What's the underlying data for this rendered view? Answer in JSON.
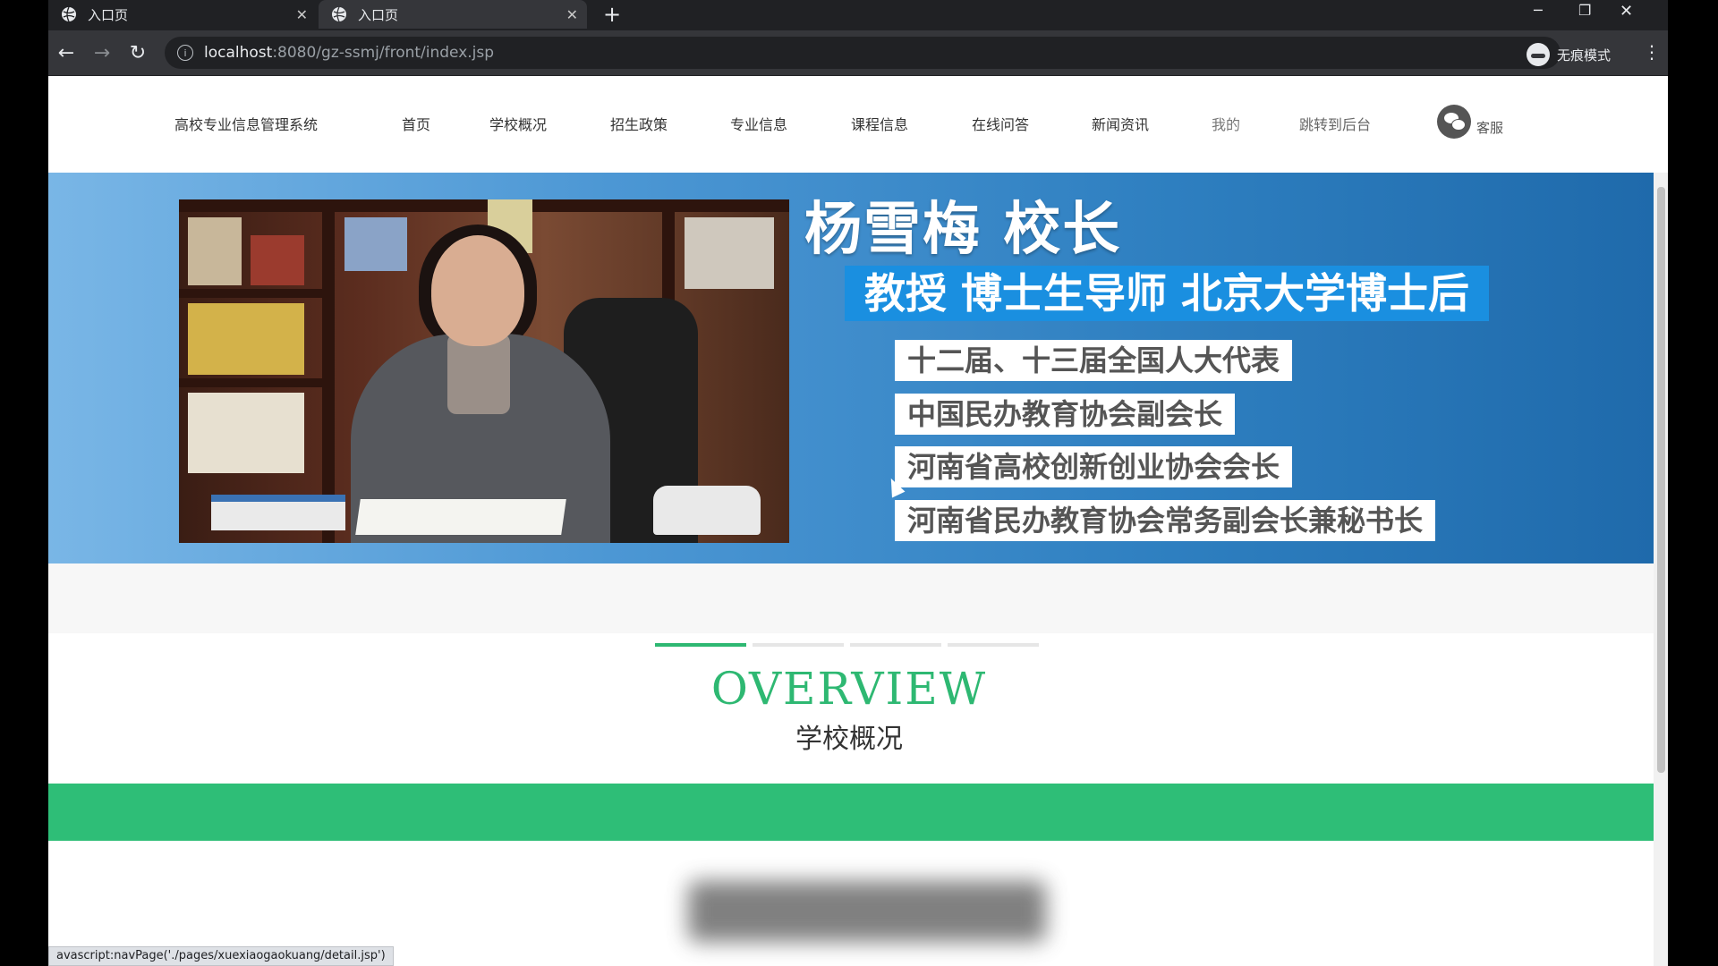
{
  "browser": {
    "tabs": [
      {
        "title": "入口页",
        "active": false
      },
      {
        "title": "入口页",
        "active": true
      }
    ],
    "new_tab": "+",
    "window_controls": {
      "minimize": "─",
      "restore": "❐",
      "close": "✕"
    },
    "url": {
      "host": "localhost",
      "rest": ":8080/gz-ssmj/front/index.jsp"
    },
    "incognito_label": "无痕模式",
    "status_text": "avascript:navPage('./pages/xuexiaogaokuang/detail.jsp')"
  },
  "nav": {
    "brand": "高校专业信息管理系统",
    "items": [
      "首页",
      "学校概况",
      "招生政策",
      "专业信息",
      "课程信息",
      "在线问答",
      "新闻资讯",
      "我的",
      "跳转到后台"
    ],
    "service": "客服"
  },
  "banner": {
    "title": "杨雪梅 校长",
    "subtitle": "教授 博士生导师 北京大学博士后",
    "lines": [
      "十二届、十三届全国人大代表",
      "中国民办教育协会副会长",
      "河南省高校创新创业协会会长",
      "河南省民办教育协会常务副会长兼秘书长"
    ]
  },
  "slider": {
    "count": 4,
    "active_index": 0
  },
  "section": {
    "title_en": "OVERVIEW",
    "title_cn": "学校概况"
  },
  "colors": {
    "accent": "#2eb872",
    "bar": "#2ebe77",
    "banner_subtitle_bg": "#1a8fe0"
  },
  "icons": [
    "globe-icon",
    "back-icon",
    "forward-icon",
    "reload-icon",
    "info-icon",
    "star-icon",
    "incognito-icon",
    "menu-icon",
    "wechat-icon"
  ]
}
